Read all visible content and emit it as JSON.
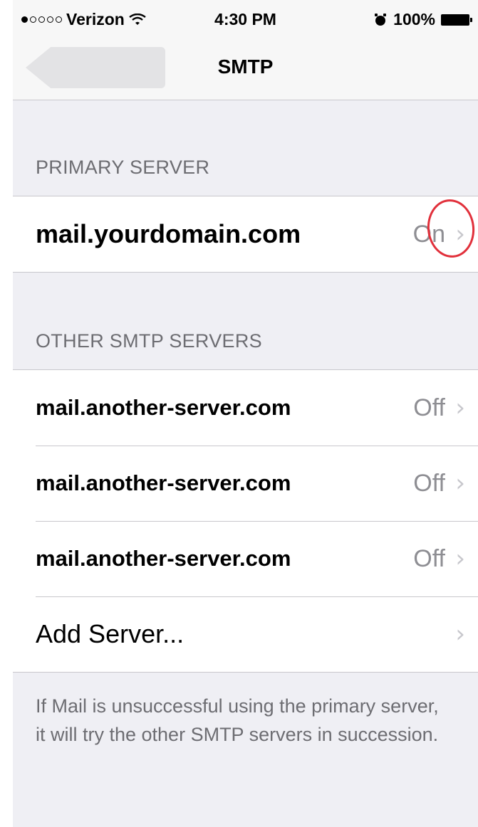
{
  "status_bar": {
    "carrier": "Verizon",
    "signal_dots": [
      true,
      false,
      false,
      false,
      false
    ],
    "time": "4:30 PM",
    "battery": "100%"
  },
  "nav": {
    "title": "SMTP"
  },
  "primary_section": {
    "header": "PRIMARY SERVER",
    "server": {
      "name": "mail.yourdomain.com",
      "status": "On"
    }
  },
  "other_section": {
    "header": "OTHER SMTP SERVERS",
    "servers": [
      {
        "name": "mail.another-server.com",
        "status": "Off"
      },
      {
        "name": "mail.another-server.com",
        "status": "Off"
      },
      {
        "name": "mail.another-server.com",
        "status": "Off"
      }
    ],
    "add_label": "Add Server..."
  },
  "footer": "If Mail is unsuccessful using the primary server, it will try the other SMTP servers in succession.",
  "icons": {
    "chevron": "chevron-right-icon",
    "wifi": "wifi-icon",
    "alarm": "alarm-icon",
    "battery": "battery-icon"
  },
  "colors": {
    "background": "#efeff4",
    "annotation": "#e1303b",
    "secondary_text": "#8e8e93"
  }
}
